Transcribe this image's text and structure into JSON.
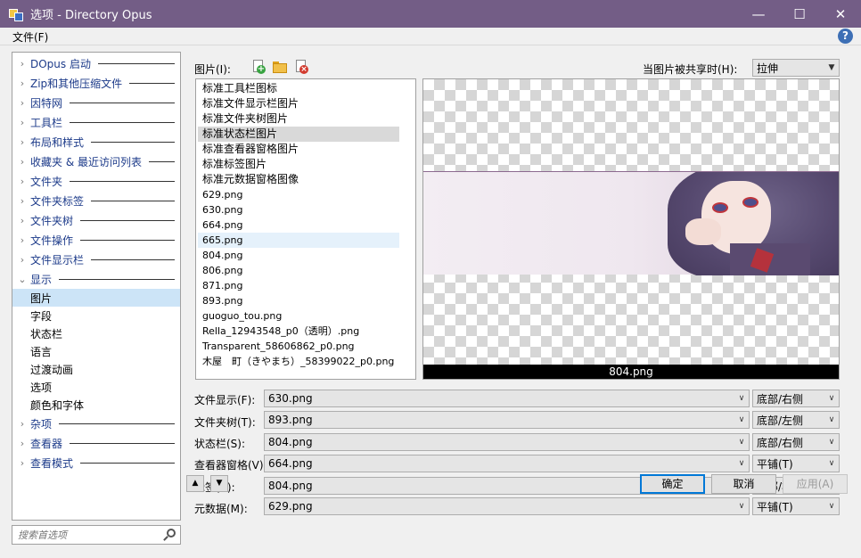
{
  "window": {
    "title": "选项 - Directory Opus"
  },
  "menubar": {
    "file": "文件(F)",
    "help": "?"
  },
  "tree": {
    "items": [
      {
        "label": "DOpus 启动",
        "chev": "›"
      },
      {
        "label": "Zip和其他压缩文件",
        "chev": "›"
      },
      {
        "label": "因特网",
        "chev": "›"
      },
      {
        "label": "工具栏",
        "chev": "›"
      },
      {
        "label": "布局和样式",
        "chev": "›"
      },
      {
        "label": "收藏夹 & 最近访问列表",
        "chev": "›"
      },
      {
        "label": "文件夹",
        "chev": "›"
      },
      {
        "label": "文件夹标签",
        "chev": "›"
      },
      {
        "label": "文件夹树",
        "chev": "›"
      },
      {
        "label": "文件操作",
        "chev": "›"
      },
      {
        "label": "文件显示栏",
        "chev": "›"
      },
      {
        "label": "显示",
        "chev": "⌄"
      },
      {
        "label": "图片"
      },
      {
        "label": "字段"
      },
      {
        "label": "状态栏"
      },
      {
        "label": "语言"
      },
      {
        "label": "过渡动画"
      },
      {
        "label": "选项"
      },
      {
        "label": "颜色和字体"
      },
      {
        "label": "杂项",
        "chev": "›"
      },
      {
        "label": "查看器",
        "chev": "›"
      },
      {
        "label": "查看模式",
        "chev": "›"
      }
    ]
  },
  "search": {
    "placeholder": "搜索首选项"
  },
  "images": {
    "label": "图片(I):",
    "share_label": "当图片被共享时(H):",
    "share_value": "拉伸",
    "list": [
      "标准工具栏图标",
      "标准文件显示栏图片",
      "标准文件夹树图片",
      "标准状态栏图片",
      "标准查看器窗格图片",
      "标准标签图片",
      "标准元数据窗格图像",
      "629.png",
      "630.png",
      "664.png",
      "665.png",
      "804.png",
      "806.png",
      "871.png",
      "893.png",
      "guoguo_tou.png",
      "Rella_12943548_p0（透明）.png",
      "Transparent_58606862_p0.png",
      "木屋　町（きやまち）_58399022_p0.png"
    ],
    "preview_caption": "804.png"
  },
  "assignments": [
    {
      "label": "文件显示(F):",
      "image": "630.png",
      "position": "底部/右侧"
    },
    {
      "label": "文件夹树(T):",
      "image": "893.png",
      "position": "底部/左侧"
    },
    {
      "label": "状态栏(S):",
      "image": "804.png",
      "position": "底部/右侧"
    },
    {
      "label": "查看器窗格(V):",
      "image": "664.png",
      "position": "平铺(T)"
    },
    {
      "label": "标签(B):",
      "image": "804.png",
      "position": "顶部/右侧"
    },
    {
      "label": "元数据(M):",
      "image": "629.png",
      "position": "平铺(T)"
    }
  ],
  "buttons": {
    "ok": "确定",
    "cancel": "取消",
    "apply": "应用(A)",
    "up": "▲",
    "down": "▼"
  },
  "colors": {
    "titlebar": "#735d86",
    "accent": "#0078d7"
  }
}
